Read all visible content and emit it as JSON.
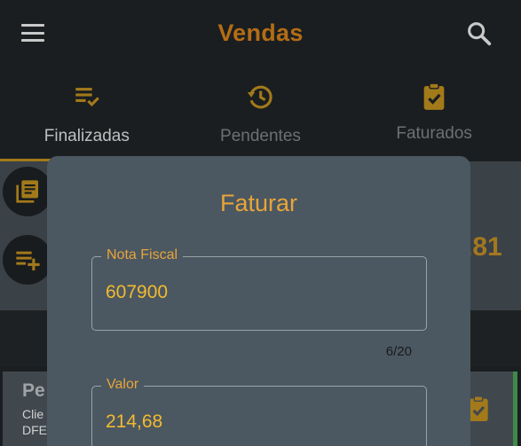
{
  "appbar": {
    "title": "Vendas",
    "menu_icon": "hamburger-menu-icon",
    "search_icon": "search-icon"
  },
  "tabs": [
    {
      "label": "Finalizadas",
      "icon": "playlist-check-icon",
      "active": true
    },
    {
      "label": "Pendentes",
      "icon": "history-icon",
      "active": false
    },
    {
      "label": "Faturados",
      "icon": "clipboard-check-icon",
      "active": false
    }
  ],
  "background": {
    "total_partial": ",81",
    "card": {
      "title_partial": "Pe",
      "line1_partial": "Clie",
      "line2_partial": "DFE"
    }
  },
  "dialog": {
    "title": "Faturar",
    "nota_fiscal": {
      "label": "Nota Fiscal",
      "value": "607900",
      "counter": "6/20"
    },
    "valor": {
      "label": "Valor",
      "value": "214,68"
    }
  },
  "colors": {
    "accent": "#e8a43a",
    "title_brand": "#b36d16",
    "field_text": "#f3ba2e",
    "dialog_bg": "#4b5861",
    "appbar_bg": "#1b1e20"
  }
}
